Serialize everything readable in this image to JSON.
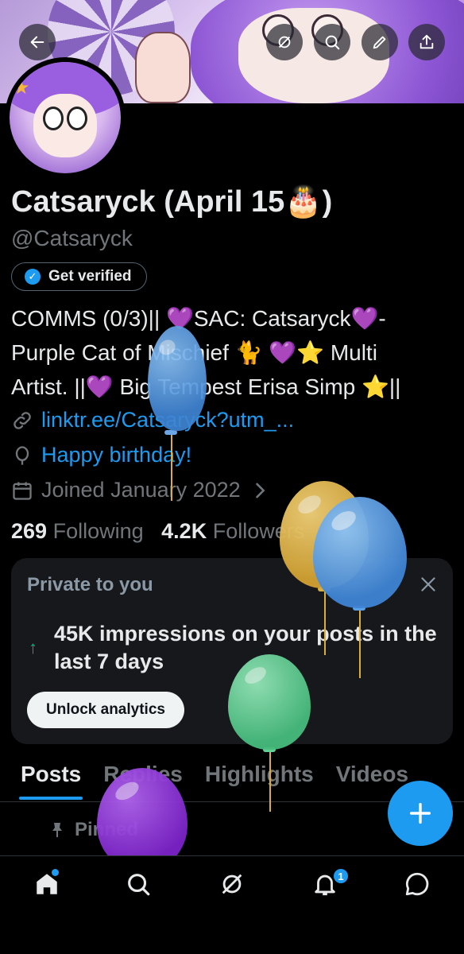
{
  "header": {
    "back_icon": "arrow-left-icon",
    "actions": [
      "grok-icon",
      "search-icon",
      "edit-icon",
      "share-icon"
    ]
  },
  "profile": {
    "display_name": "Catsaryck (April 15🎂)",
    "handle": "@Catsaryck",
    "get_verified_label": "Get verified",
    "bio_lines": [
      "COMMS (0/3)|| 💜SAC: Catsaryck💜-",
      "Purple Cat of Mischief 🐈 💜⭐ Multi",
      "Artist. ||💜 Big Tempest Erisa Simp ⭐||"
    ],
    "link": "linktr.ee/Catsaryck?utm_...",
    "birthday": "Happy birthday!",
    "joined": "Joined January 2022",
    "following_count": "269",
    "following_label": "Following",
    "followers_count": "4.2K",
    "followers_label": "Followers"
  },
  "private_card": {
    "title": "Private to you",
    "stat": "45K impressions on your posts in the last 7 days",
    "button": "Unlock analytics"
  },
  "tabs": [
    "Posts",
    "Replies",
    "Highlights",
    "Videos"
  ],
  "active_tab": "Posts",
  "pinned_label": "Pinned",
  "bottom_nav": {
    "items": [
      "home-icon",
      "search-icon",
      "grok-icon",
      "notifications-icon",
      "messages-icon"
    ],
    "notification_count": "1"
  },
  "colors": {
    "accent": "#1d9bf0",
    "background": "#000000",
    "card": "#16181c",
    "muted": "#71767b",
    "balloon_blue": "#4a8fde",
    "balloon_yellow": "#d9ae3a",
    "balloon_green": "#56c98a",
    "balloon_purple": "#8a2bd6"
  }
}
